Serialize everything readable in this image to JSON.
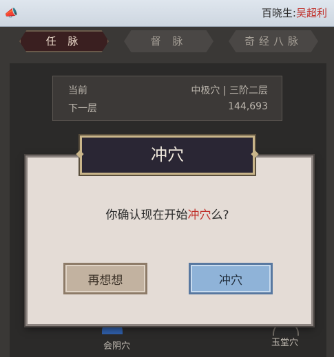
{
  "announcement": {
    "icon": "megaphone-icon",
    "prefix": "百晓生:",
    "highlight": "吴超利"
  },
  "tabs": [
    {
      "label": "任 脉",
      "active": true
    },
    {
      "label": "督 脉",
      "active": false
    },
    {
      "label": "奇经八脉",
      "active": false
    }
  ],
  "info": {
    "current_label": "当前",
    "current_value": "中极穴 | 三阶二层",
    "next_label": "下一层",
    "next_value": "144,693"
  },
  "nodes": {
    "left_label": "会阴穴",
    "right_label": "玉堂穴"
  },
  "dialog": {
    "title": "冲穴",
    "message_pre": "你确认现在开始",
    "message_highlight": "冲穴",
    "message_post": "么?",
    "cancel_label": "再想想",
    "confirm_label": "冲穴"
  },
  "colors": {
    "highlight_red": "#c0302a",
    "confirm_blue": "#8fb3d8",
    "cancel_tan": "#c2b2a0",
    "title_dark": "#2a2634"
  }
}
